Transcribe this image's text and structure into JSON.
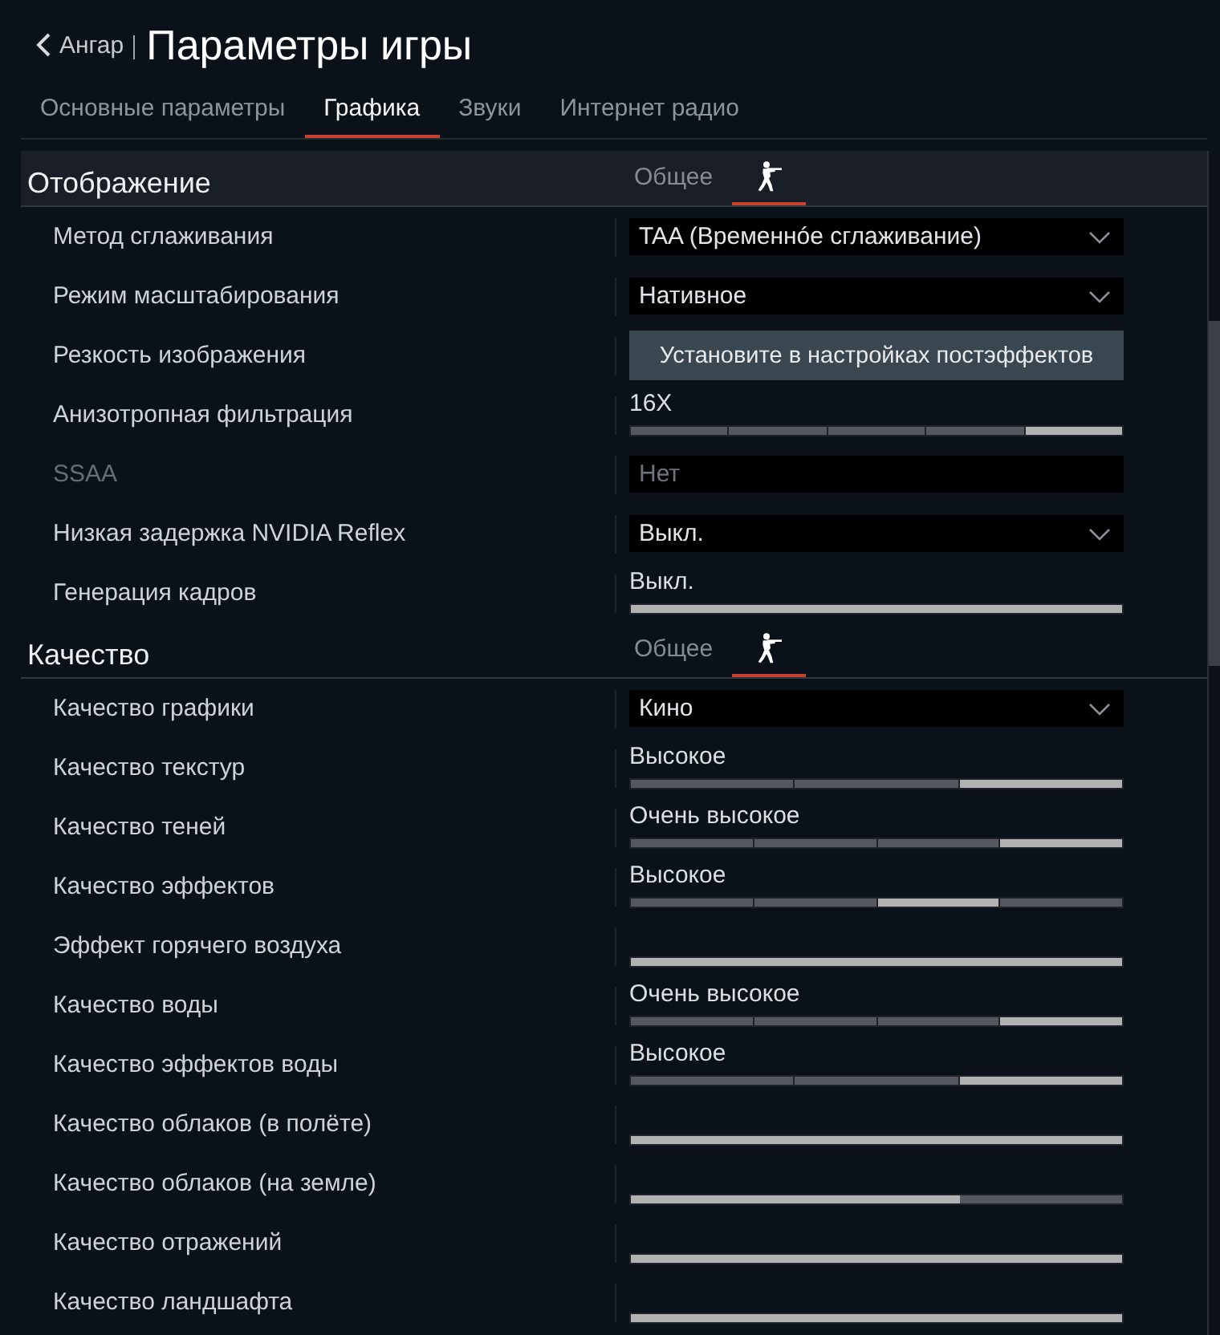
{
  "header": {
    "back_label": "Ангар",
    "title": "Параметры игры"
  },
  "tabs": [
    {
      "label": "Основные параметры",
      "selected": false
    },
    {
      "label": "Графика",
      "selected": true
    },
    {
      "label": "Звуки",
      "selected": false
    },
    {
      "label": "Интернет радио",
      "selected": false
    }
  ],
  "sections": [
    {
      "title": "Отображение",
      "highlighted": true,
      "view_tabs": [
        {
          "kind": "text",
          "label": "Общее",
          "selected": false
        },
        {
          "kind": "icon",
          "selected": true
        }
      ],
      "rows": [
        {
          "label": "Метод сглаживания",
          "disabled": false,
          "kind": "dropdown",
          "value": "TAA (Временнóе сглаживание)"
        },
        {
          "label": "Режим масштабирования",
          "disabled": false,
          "kind": "dropdown",
          "value": "Нативное"
        },
        {
          "label": "Резкость изображения",
          "disabled": false,
          "kind": "button",
          "value": "Установите в настройках постэффектов"
        },
        {
          "label": "Анизотропная фильтрация",
          "disabled": false,
          "kind": "segmented",
          "value": "16X",
          "segments": [
            {
              "selected": false
            },
            {
              "selected": false
            },
            {
              "selected": false
            },
            {
              "selected": false
            },
            {
              "selected": true
            }
          ]
        },
        {
          "label": "SSAA",
          "disabled": true,
          "kind": "field",
          "value": "Нет"
        },
        {
          "label": "Низкая задержка NVIDIA Reflex",
          "disabled": false,
          "kind": "dropdown",
          "value": "Выкл."
        },
        {
          "label": "Генерация кадров",
          "disabled": false,
          "kind": "segmented",
          "value": "Выкл.",
          "segments": [
            {
              "selected": true
            }
          ]
        }
      ]
    },
    {
      "title": "Качество",
      "highlighted": false,
      "view_tabs": [
        {
          "kind": "text",
          "label": "Общее",
          "selected": false
        },
        {
          "kind": "icon",
          "selected": true
        }
      ],
      "rows": [
        {
          "label": "Качество графики",
          "disabled": false,
          "kind": "dropdown",
          "value": "Кино"
        },
        {
          "label": "Качество текстур",
          "disabled": false,
          "kind": "segmented",
          "value": "Высокое",
          "segments": [
            {
              "selected": false
            },
            {
              "selected": false
            },
            {
              "selected": true
            }
          ]
        },
        {
          "label": "Качество теней",
          "disabled": false,
          "kind": "segmented",
          "value": "Очень высокое",
          "segments": [
            {
              "selected": false
            },
            {
              "selected": false
            },
            {
              "selected": false
            },
            {
              "selected": true
            }
          ]
        },
        {
          "label": "Качество эффектов",
          "disabled": false,
          "kind": "segmented",
          "value": "Высокое",
          "segments": [
            {
              "selected": false
            },
            {
              "selected": false
            },
            {
              "selected": true
            },
            {
              "selected": false
            }
          ]
        },
        {
          "label": "Эффект горячего воздуха",
          "disabled": false,
          "kind": "fill",
          "level": 1
        },
        {
          "label": "Качество воды",
          "disabled": false,
          "kind": "segmented",
          "value": "Очень высокое",
          "segments": [
            {
              "selected": false
            },
            {
              "selected": false
            },
            {
              "selected": false
            },
            {
              "selected": true
            }
          ]
        },
        {
          "label": "Качество эффектов воды",
          "disabled": false,
          "kind": "segmented",
          "value": "Высокое",
          "segments": [
            {
              "selected": false
            },
            {
              "selected": false
            },
            {
              "selected": true
            }
          ]
        },
        {
          "label": "Качество облаков (в полёте)",
          "disabled": false,
          "kind": "fill",
          "level": 1
        },
        {
          "label": "Качество облаков (на земле)",
          "disabled": false,
          "kind": "fill",
          "level": 0.67
        },
        {
          "label": "Качество отражений",
          "disabled": false,
          "kind": "fill",
          "level": 1
        },
        {
          "label": "Качество ландшафта",
          "disabled": false,
          "kind": "fill",
          "level": 1
        }
      ]
    }
  ]
}
